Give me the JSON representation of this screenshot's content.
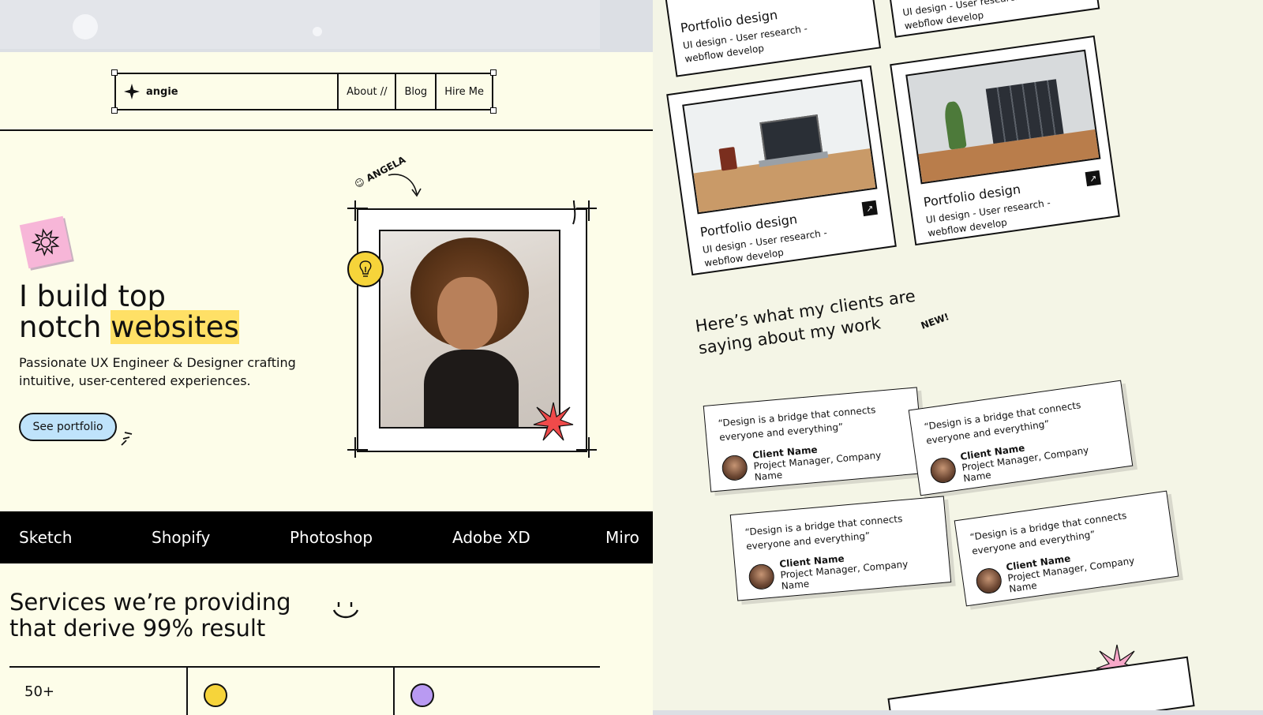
{
  "nav": {
    "brand": "angie",
    "items": [
      "About //",
      "Blog",
      "Hire Me"
    ]
  },
  "hero": {
    "title_line1": "I build top",
    "title_line2_plain": "notch ",
    "title_line2_highlight": "websites",
    "subtitle": "Passionate UX Engineer & Designer crafting intuitive, user-centered experiences.",
    "cta": "See portfolio",
    "tag": "ANGELA"
  },
  "skills": [
    "Sketch",
    "Shopify",
    "Photoshop",
    "Adobe XD",
    "Miro"
  ],
  "services": {
    "title_line1": "Services we’re providing",
    "title_line2": "that derive 99% result",
    "stat": "50+"
  },
  "portfolio": {
    "cards": [
      {
        "title": "Portfolio design",
        "line1": "UI design - User research -",
        "line2": "webflow develop"
      },
      {
        "title": "Portfolio design",
        "line1": "UI design - User research -",
        "line2": "webflow develop"
      },
      {
        "title": "Portfolio design",
        "line1": "UI design - User research -",
        "line2": "webflow develop"
      },
      {
        "title": "Portfolio design",
        "line1": "UI design - User research -",
        "line2": "webflow develop"
      }
    ],
    "top_partial_text": "UI design - User research -"
  },
  "clients": {
    "title_line1": "Here’s what my clients are",
    "title_line2": "saying about my work",
    "new_tag": "NEW!",
    "testimonials": [
      {
        "quote_line1": "“Design is a bridge that connects",
        "quote_line2": "everyone and everything”",
        "name": "Client Name",
        "role": "Project Manager, Company Name"
      },
      {
        "quote_line1": "“Design is a bridge that connects",
        "quote_line2": "everyone and everything”",
        "name": "Client Name",
        "role": "Project Manager, Company Name"
      },
      {
        "quote_line1": "“Design is a bridge that connects",
        "quote_line2": "everyone and everything”",
        "name": "Client Name",
        "role": "Project Manager, Company Name"
      },
      {
        "quote_line1": "“Design is a bridge that connects",
        "quote_line2": "everyone and everything”",
        "name": "Client Name",
        "role": "Project Manager, Company Name"
      }
    ]
  },
  "colors": {
    "page_bg": "#fdfde9",
    "highlight": "#ffe066",
    "button_blue": "#bfe3fb",
    "sticky_pink": "#f7b6d8",
    "bulb_yellow": "#f6d43a",
    "star_red": "#f04a4a",
    "band_black": "#000000"
  }
}
